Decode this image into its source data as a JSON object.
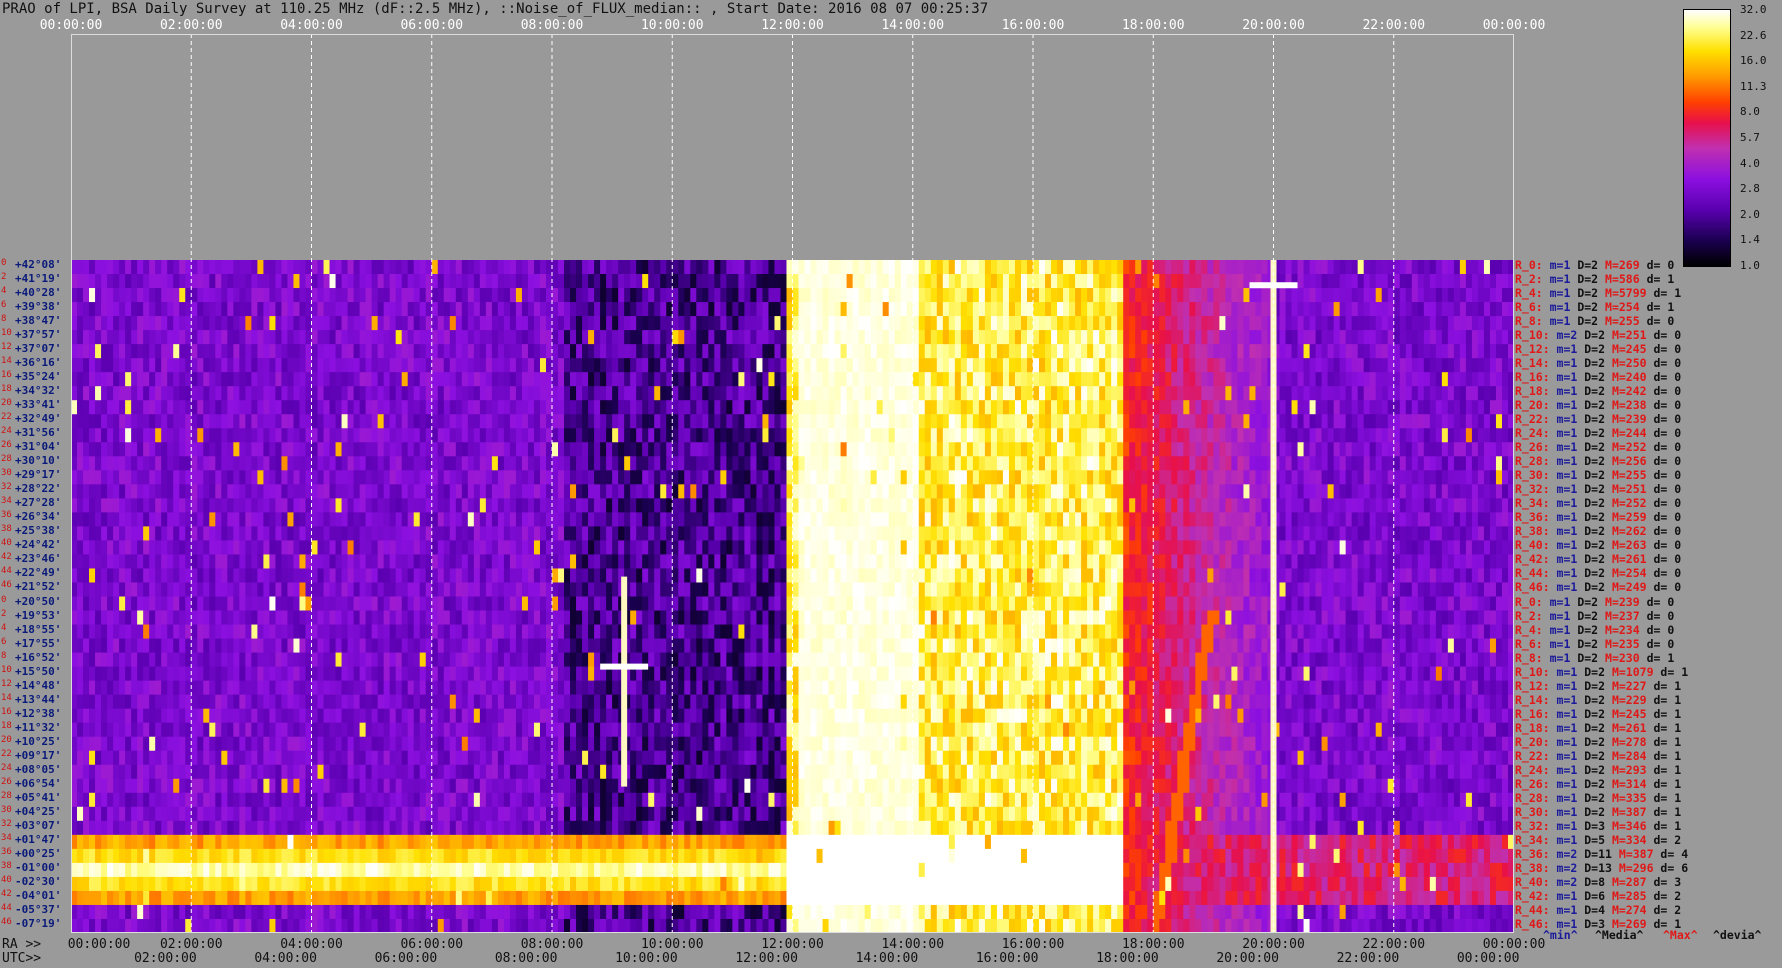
{
  "title": "PRAO of LPI, BSA Daily Survey at 110.25 MHz (dF::2.5 MHz), ::Noise_of_FLUX_median:: , Start Date: 2016 08 07 00:25:37",
  "chart_data": {
    "type": "heatmap",
    "title": "PRAO of LPI, BSA Daily Survey at 110.25 MHz (dF::2.5 MHz), ::Noise_of_FLUX_median:: , Start Date: 2016 08 07 00:25:37",
    "x_unit": "hours",
    "xlim": [
      0,
      24
    ],
    "top_ticks": [
      "00:00:00",
      "02:00:00",
      "04:00:00",
      "06:00:00",
      "08:00:00",
      "10:00:00",
      "12:00:00",
      "14:00:00",
      "16:00:00",
      "18:00:00",
      "20:00:00",
      "22:00:00",
      "00:00:00"
    ],
    "ra_prefix": "RA >>",
    "ra_ticks": [
      "00:00:00",
      "02:00:00",
      "04:00:00",
      "06:00:00",
      "08:00:00",
      "10:00:00",
      "12:00:00",
      "14:00:00",
      "16:00:00",
      "18:00:00",
      "20:00:00",
      "22:00:00",
      "00:00:00"
    ],
    "utc_prefix": "UTC>>",
    "utc_ticks": [
      "02:00:00",
      "04:00:00",
      "06:00:00",
      "08:00:00",
      "10:00:00",
      "12:00:00",
      "14:00:00",
      "16:00:00",
      "18:00:00",
      "20:00:00",
      "22:00:00",
      "00:00:00"
    ],
    "declinations": [
      "+42°08'",
      "+41°19'",
      "+40°28'",
      "+39°38'",
      "+38°47'",
      "+37°57'",
      "+37°07'",
      "+36°16'",
      "+35°24'",
      "+34°32'",
      "+33°41'",
      "+32°49'",
      "+31°56'",
      "+31°04'",
      "+30°10'",
      "+29°17'",
      "+28°22'",
      "+27°28'",
      "+26°34'",
      "+25°38'",
      "+24°42'",
      "+23°46'",
      "+22°49'",
      "+21°52'",
      "+20°50'",
      "+19°53'",
      "+18°55'",
      "+17°55'",
      "+16°52'",
      "+15°50'",
      "+14°48'",
      "+13°44'",
      "+12°38'",
      "+11°32'",
      "+10°25'",
      "+09°17'",
      "+08°05'",
      "+06°54'",
      "+05°41'",
      "+04°25'",
      "+03°07'",
      "+01°47'",
      "+00°25'",
      "-01°00'",
      "-02°30'",
      "-04°01'",
      "-05°37'",
      "-07°19'"
    ],
    "row_indices": [
      "0",
      "2",
      "4",
      "6",
      "8",
      "10",
      "12",
      "14",
      "16",
      "18",
      "20",
      "22",
      "24",
      "26",
      "28",
      "30",
      "32",
      "34",
      "36",
      "38",
      "40",
      "42",
      "44",
      "46",
      "0",
      "2",
      "4",
      "6",
      "8",
      "10",
      "12",
      "14",
      "16",
      "18",
      "20",
      "22",
      "24",
      "26",
      "28",
      "30",
      "32",
      "34",
      "36",
      "38",
      "40",
      "42",
      "44",
      "46"
    ],
    "colorbar": {
      "ticks": [
        "32.0",
        "22.6",
        "16.0",
        "11.3",
        "8.0",
        "5.7",
        "4.0",
        "2.8",
        "2.0",
        "1.4",
        "1.0"
      ],
      "scale": "log2",
      "range": [
        1.0,
        32.0
      ],
      "colors": [
        "#000000",
        "#1a0050",
        "#5a00b0",
        "#8c10e0",
        "#c030b0",
        "#e8104a",
        "#ff4000",
        "#ff9a00",
        "#ffe000",
        "#ffff90",
        "#ffffff"
      ]
    },
    "bright_band_hours": [
      11.9,
      17.5
    ],
    "source_hours": [
      9.2,
      20.0
    ],
    "legend_rows": [
      {
        "name": "R_0:",
        "min": "m=1",
        "d": "D=2",
        "max": "M=269",
        "dev": "d= 0"
      },
      {
        "name": "R_2:",
        "min": "m=1",
        "d": "D=2",
        "max": "M=586",
        "dev": "d= 1"
      },
      {
        "name": "R_4:",
        "min": "m=1",
        "d": "D=2",
        "max": "M=5799",
        "dev": "d= 1"
      },
      {
        "name": "R_6:",
        "min": "m=1",
        "d": "D=2",
        "max": "M=254",
        "dev": "d= 1"
      },
      {
        "name": "R_8:",
        "min": "m=1",
        "d": "D=2",
        "max": "M=255",
        "dev": "d= 0"
      },
      {
        "name": "R_10:",
        "min": "m=2",
        "d": "D=2",
        "max": "M=251",
        "dev": "d= 0"
      },
      {
        "name": "R_12:",
        "min": "m=1",
        "d": "D=2",
        "max": "M=245",
        "dev": "d= 0"
      },
      {
        "name": "R_14:",
        "min": "m=1",
        "d": "D=2",
        "max": "M=250",
        "dev": "d= 0"
      },
      {
        "name": "R_16:",
        "min": "m=1",
        "d": "D=2",
        "max": "M=240",
        "dev": "d= 0"
      },
      {
        "name": "R_18:",
        "min": "m=1",
        "d": "D=2",
        "max": "M=242",
        "dev": "d= 0"
      },
      {
        "name": "R_20:",
        "min": "m=1",
        "d": "D=2",
        "max": "M=238",
        "dev": "d= 0"
      },
      {
        "name": "R_22:",
        "min": "m=1",
        "d": "D=2",
        "max": "M=239",
        "dev": "d= 0"
      },
      {
        "name": "R_24:",
        "min": "m=1",
        "d": "D=2",
        "max": "M=244",
        "dev": "d= 0"
      },
      {
        "name": "R_26:",
        "min": "m=1",
        "d": "D=2",
        "max": "M=252",
        "dev": "d= 0"
      },
      {
        "name": "R_28:",
        "min": "m=1",
        "d": "D=2",
        "max": "M=256",
        "dev": "d= 0"
      },
      {
        "name": "R_30:",
        "min": "m=1",
        "d": "D=2",
        "max": "M=255",
        "dev": "d= 0"
      },
      {
        "name": "R_32:",
        "min": "m=1",
        "d": "D=2",
        "max": "M=251",
        "dev": "d= 0"
      },
      {
        "name": "R_34:",
        "min": "m=1",
        "d": "D=2",
        "max": "M=252",
        "dev": "d= 0"
      },
      {
        "name": "R_36:",
        "min": "m=1",
        "d": "D=2",
        "max": "M=259",
        "dev": "d= 0"
      },
      {
        "name": "R_38:",
        "min": "m=1",
        "d": "D=2",
        "max": "M=262",
        "dev": "d= 0"
      },
      {
        "name": "R_40:",
        "min": "m=1",
        "d": "D=2",
        "max": "M=263",
        "dev": "d= 0"
      },
      {
        "name": "R_42:",
        "min": "m=1",
        "d": "D=2",
        "max": "M=261",
        "dev": "d= 0"
      },
      {
        "name": "R_44:",
        "min": "m=1",
        "d": "D=2",
        "max": "M=254",
        "dev": "d= 0"
      },
      {
        "name": "R_46:",
        "min": "m=1",
        "d": "D=2",
        "max": "M=249",
        "dev": "d= 0"
      },
      {
        "name": "R_0:",
        "min": "m=1",
        "d": "D=2",
        "max": "M=239",
        "dev": "d= 0"
      },
      {
        "name": "R_2:",
        "min": "m=1",
        "d": "D=2",
        "max": "M=237",
        "dev": "d= 0"
      },
      {
        "name": "R_4:",
        "min": "m=1",
        "d": "D=2",
        "max": "M=234",
        "dev": "d= 0"
      },
      {
        "name": "R_6:",
        "min": "m=1",
        "d": "D=2",
        "max": "M=235",
        "dev": "d= 0"
      },
      {
        "name": "R_8:",
        "min": "m=1",
        "d": "D=2",
        "max": "M=230",
        "dev": "d= 1"
      },
      {
        "name": "R_10:",
        "min": "m=1",
        "d": "D=2",
        "max": "M=1079",
        "dev": "d= 1"
      },
      {
        "name": "R_12:",
        "min": "m=1",
        "d": "D=2",
        "max": "M=227",
        "dev": "d= 1"
      },
      {
        "name": "R_14:",
        "min": "m=1",
        "d": "D=2",
        "max": "M=229",
        "dev": "d= 1"
      },
      {
        "name": "R_16:",
        "min": "m=1",
        "d": "D=2",
        "max": "M=245",
        "dev": "d= 1"
      },
      {
        "name": "R_18:",
        "min": "m=1",
        "d": "D=2",
        "max": "M=261",
        "dev": "d= 1"
      },
      {
        "name": "R_20:",
        "min": "m=1",
        "d": "D=2",
        "max": "M=278",
        "dev": "d= 1"
      },
      {
        "name": "R_22:",
        "min": "m=1",
        "d": "D=2",
        "max": "M=284",
        "dev": "d= 1"
      },
      {
        "name": "R_24:",
        "min": "m=1",
        "d": "D=2",
        "max": "M=293",
        "dev": "d= 1"
      },
      {
        "name": "R_26:",
        "min": "m=1",
        "d": "D=2",
        "max": "M=314",
        "dev": "d= 1"
      },
      {
        "name": "R_28:",
        "min": "m=1",
        "d": "D=2",
        "max": "M=335",
        "dev": "d= 1"
      },
      {
        "name": "R_30:",
        "min": "m=1",
        "d": "D=2",
        "max": "M=387",
        "dev": "d= 1"
      },
      {
        "name": "R_32:",
        "min": "m=1",
        "d": "D=3",
        "max": "M=346",
        "dev": "d= 1"
      },
      {
        "name": "R_34:",
        "min": "m=1",
        "d": "D=5",
        "max": "M=334",
        "dev": "d= 2"
      },
      {
        "name": "R_36:",
        "min": "m=2",
        "d": "D=11",
        "max": "M=387",
        "dev": "d= 4"
      },
      {
        "name": "R_38:",
        "min": "m=2",
        "d": "D=13",
        "max": "M=296",
        "dev": "d= 6"
      },
      {
        "name": "R_40:",
        "min": "m=2",
        "d": "D=8",
        "max": "M=287",
        "dev": "d= 3"
      },
      {
        "name": "R_42:",
        "min": "m=1",
        "d": "D=6",
        "max": "M=285",
        "dev": "d= 2"
      },
      {
        "name": "R_44:",
        "min": "m=1",
        "d": "D=4",
        "max": "M=274",
        "dev": "d= 2"
      },
      {
        "name": "R_46:",
        "min": "m=1",
        "d": "D=3",
        "max": "M=269",
        "dev": "d= 1"
      }
    ],
    "legend_footer": {
      "min": "^min^",
      "media": "^Media^",
      "max": "^Max^",
      "devia": "^devia^"
    }
  }
}
